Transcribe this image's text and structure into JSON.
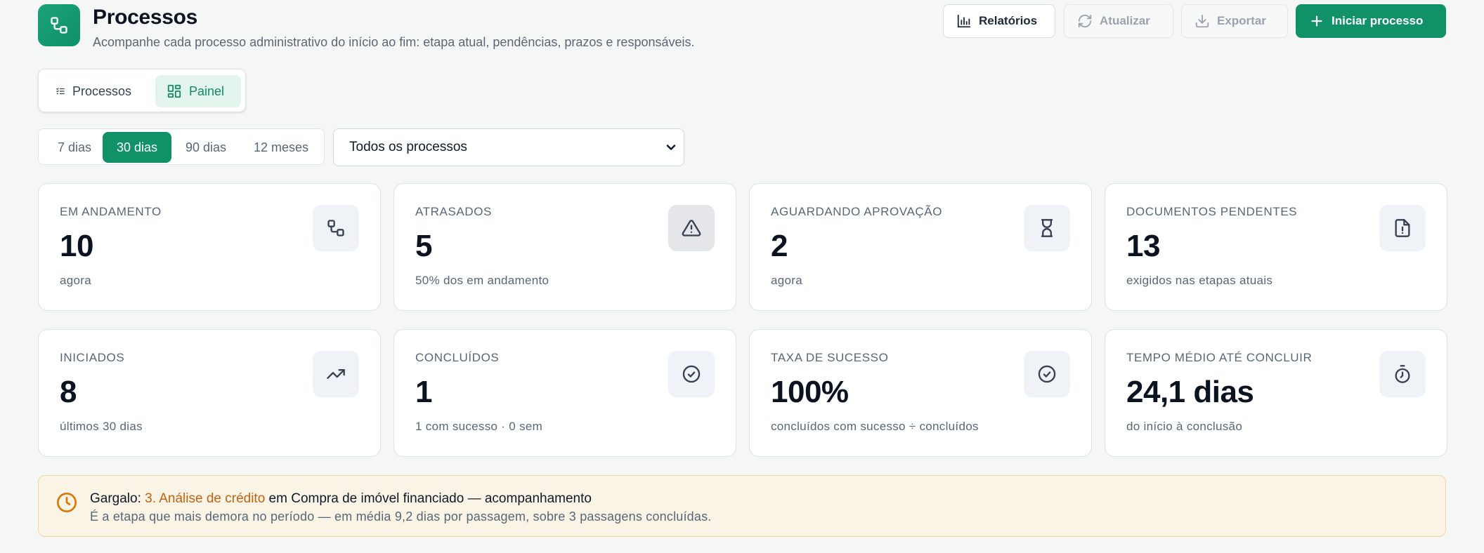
{
  "header": {
    "title": "Processos",
    "subtitle": "Acompanhe cada processo administrativo do início ao fim: etapa atual, pendências, prazos e responsáveis.",
    "buttons": {
      "reports": "Relatórios",
      "refresh": "Atualizar",
      "export": "Exportar",
      "start": "Iniciar processo"
    }
  },
  "view_tabs": [
    {
      "label": "Processos",
      "icon": "list-check-icon",
      "active": false
    },
    {
      "label": "Painel",
      "icon": "dashboard-icon",
      "active": true
    }
  ],
  "periods": [
    {
      "label": "7 dias",
      "active": false
    },
    {
      "label": "30 dias",
      "active": true
    },
    {
      "label": "90 dias",
      "active": false
    },
    {
      "label": "12 meses",
      "active": false
    }
  ],
  "process_filter": {
    "selected": "Todos os processos"
  },
  "kpis": [
    {
      "label": "EM ANDAMENTO",
      "value": "10",
      "note": "agora",
      "icon": "process-icon"
    },
    {
      "label": "ATRASADOS",
      "value": "5",
      "note": "50% dos em andamento",
      "icon": "alert-triangle-icon"
    },
    {
      "label": "AGUARDANDO APROVAÇÃO",
      "value": "2",
      "note": "agora",
      "icon": "hourglass-icon"
    },
    {
      "label": "DOCUMENTOS PENDENTES",
      "value": "13",
      "note": "exigidos nas etapas atuais",
      "icon": "document-alert-icon"
    },
    {
      "label": "INICIADOS",
      "value": "8",
      "note": "últimos 30 dias",
      "icon": "trending-up-icon"
    },
    {
      "label": "CONCLUÍDOS",
      "value": "1",
      "note": "1 com sucesso · 0 sem",
      "icon": "check-circle-icon"
    },
    {
      "label": "TAXA DE SUCESSO",
      "value": "100%",
      "note": "concluídos com sucesso ÷ concluídos",
      "icon": "check-circle-icon"
    },
    {
      "label": "TEMPO MÉDIO ATÉ CONCLUIR",
      "value": "24,1 dias",
      "note": "do início à conclusão",
      "icon": "stopwatch-icon"
    }
  ],
  "bottleneck": {
    "prefix": "Gargalo: ",
    "step": "3. Análise de crédito",
    "suffix": " em Compra de imóvel financiado — acompanhamento",
    "detail": "É a etapa que mais demora no período — em média 9,2 dias por passagem, sobre 3 passagens concluídas.",
    "icon": "clock-icon"
  },
  "colors": {
    "primary": "#109168",
    "primary_soft": "#e3f4ed",
    "warning_text": "#c0620f",
    "warning_bg": "#faf4e6",
    "warning_border": "#f0d79c"
  }
}
